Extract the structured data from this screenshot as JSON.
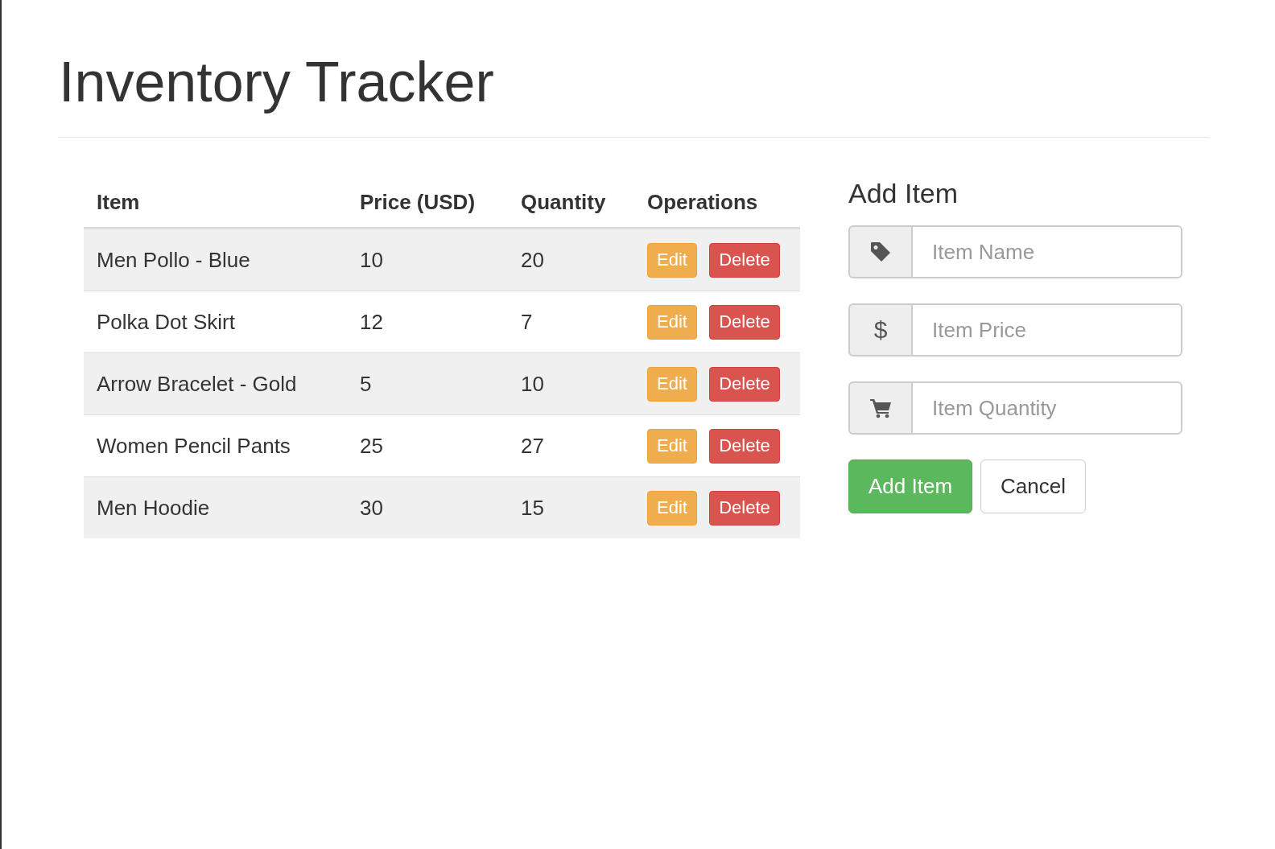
{
  "title": "Inventory Tracker",
  "table": {
    "columns": [
      "Item",
      "Price (USD)",
      "Quantity",
      "Operations"
    ],
    "rows": [
      {
        "item": "Men Pollo - Blue",
        "price": "10",
        "quantity": "20",
        "edit": "Edit",
        "delete": "Delete"
      },
      {
        "item": "Polka Dot Skirt",
        "price": "12",
        "quantity": "7",
        "edit": "Edit",
        "delete": "Delete"
      },
      {
        "item": "Arrow Bracelet - Gold",
        "price": "5",
        "quantity": "10",
        "edit": "Edit",
        "delete": "Delete"
      },
      {
        "item": "Women Pencil Pants",
        "price": "25",
        "quantity": "27",
        "edit": "Edit",
        "delete": "Delete"
      },
      {
        "item": "Men Hoodie",
        "price": "30",
        "quantity": "15",
        "edit": "Edit",
        "delete": "Delete"
      }
    ]
  },
  "form": {
    "title": "Add Item",
    "fields": [
      {
        "kind": "tag",
        "placeholder": "Item Name"
      },
      {
        "kind": "text",
        "symbol": "$",
        "placeholder": "Item Price"
      },
      {
        "kind": "cart",
        "placeholder": "Item Quantity"
      }
    ],
    "buttons": [
      {
        "kind": "primary",
        "label": "Add Item"
      },
      {
        "kind": "default",
        "label": "Cancel"
      }
    ]
  }
}
